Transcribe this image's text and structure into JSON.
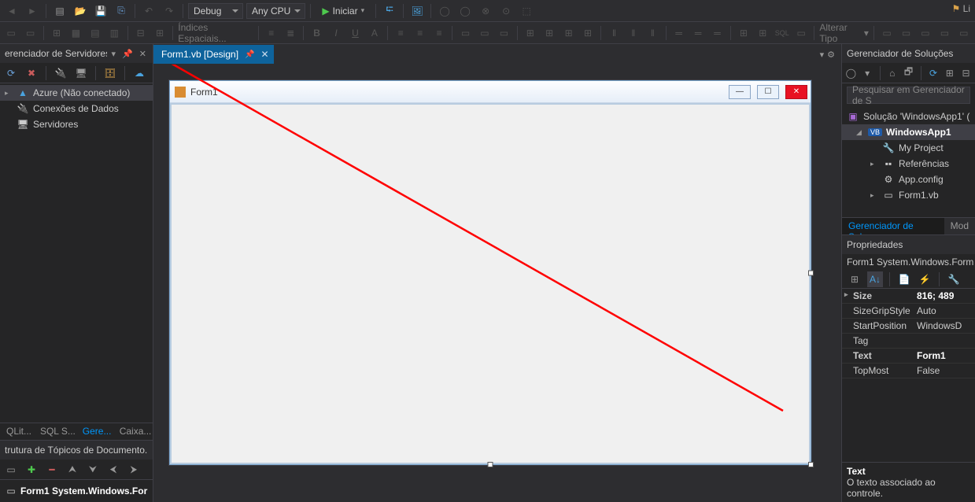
{
  "topright_label": "Li",
  "toolbar1": {
    "config": "Debug",
    "platform": "Any CPU",
    "start": "Iniciar"
  },
  "toolbar2": {
    "spatial": "Índices Espaciais...",
    "change_type": "Alterar Tipo"
  },
  "server_explorer": {
    "title": "erenciador de Servidores",
    "items": {
      "azure": "Azure (Não conectado)",
      "data_conn": "Conexões de Dados",
      "servers": "Servidores"
    },
    "bottom_tabs": {
      "sqlite": "QLit...",
      "sqls": "SQL S...",
      "gere": "Gere...",
      "caixa": "Caixa..."
    }
  },
  "doc_outline": {
    "title": "trutura de Tópicos de Documento...",
    "row": "Form1  System.Windows.For"
  },
  "doc_tab": {
    "name": "Form1.vb [Design]"
  },
  "form": {
    "title": "Form1"
  },
  "solution_explorer": {
    "title": "Gerenciador de Soluções",
    "search_placeholder": "Pesquisar em Gerenciador de S",
    "solution": "Solução 'WindowsApp1' (",
    "project": "WindowsApp1",
    "myproject": "My Project",
    "references": "Referências",
    "appconfig": "App.config",
    "form1": "Form1.vb",
    "tabs": {
      "sol": "Gerenciador de Solu...",
      "mode": "Mod"
    }
  },
  "properties": {
    "title": "Propriedades",
    "object": "Form1 System.Windows.Form",
    "rows": {
      "size": {
        "n": "Size",
        "v": "816; 489"
      },
      "sizegrip": {
        "n": "SizeGripStyle",
        "v": "Auto"
      },
      "startpos": {
        "n": "StartPosition",
        "v": "WindowsD"
      },
      "tag": {
        "n": "Tag",
        "v": ""
      },
      "text": {
        "n": "Text",
        "v": "Form1"
      },
      "topmost": {
        "n": "TopMost",
        "v": "False"
      }
    },
    "desc_title": "Text",
    "desc_body": "O texto associado ao controle."
  }
}
